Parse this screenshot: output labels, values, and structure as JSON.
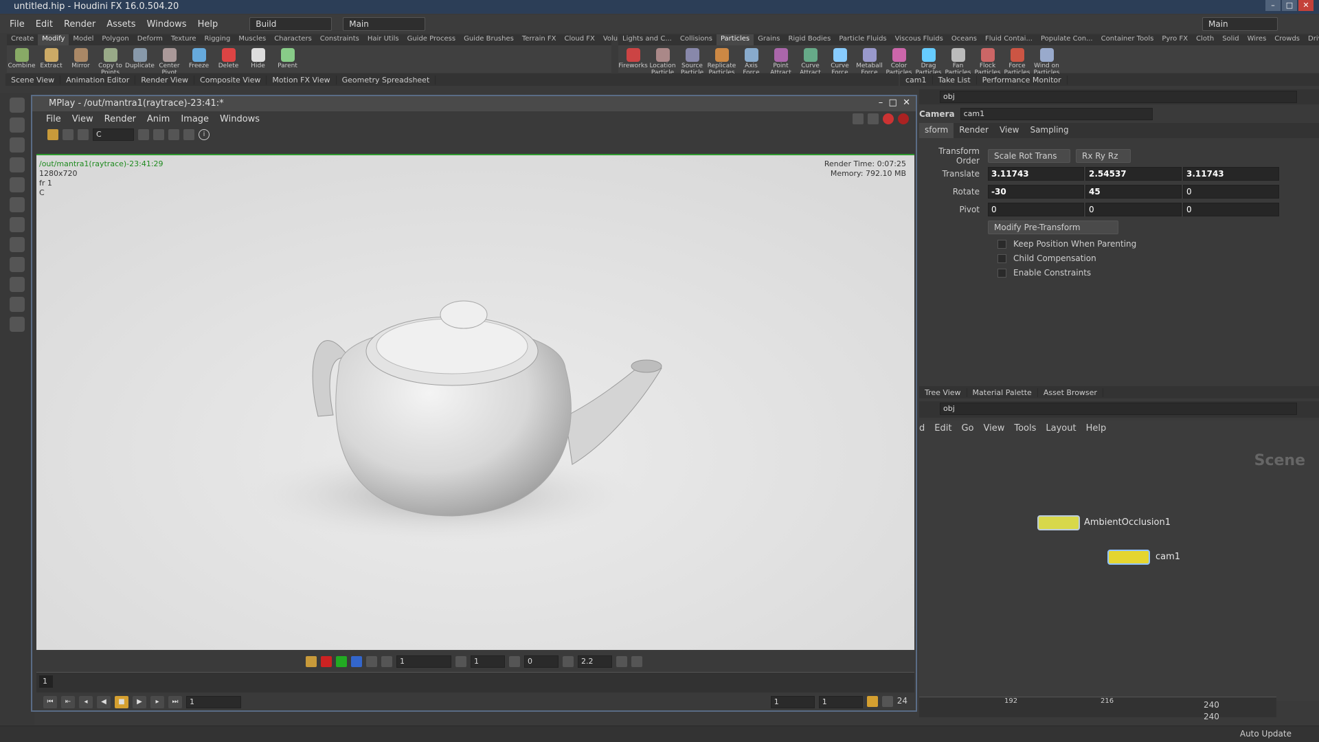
{
  "title": "untitled.hip - Houdini FX 16.0.504.20",
  "menu": [
    "File",
    "Edit",
    "Render",
    "Assets",
    "Windows",
    "Help"
  ],
  "desktop": {
    "build": "Build",
    "main": "Main",
    "right_main": "Main"
  },
  "shelf_tabs_left": [
    "Create",
    "Modify",
    "Model",
    "Polygon",
    "Deform",
    "Texture",
    "Rigging",
    "Muscles",
    "Characters",
    "Constraints",
    "Hair Utils",
    "Guide Process",
    "Guide Brushes",
    "Terrain FX",
    "Cloud FX",
    "Volume"
  ],
  "shelf_tabs_right": [
    "Lights and C...",
    "Collisions",
    "Particles",
    "Grains",
    "Rigid Bodies",
    "Particle Fluids",
    "Viscous Fluids",
    "Oceans",
    "Fluid Contai...",
    "Populate Con...",
    "Container Tools",
    "Pyro FX",
    "Cloth",
    "Solid",
    "Wires",
    "Crowds",
    "Drive Simula..."
  ],
  "tools_left": [
    "Combine",
    "Extract",
    "Mirror",
    "Copy to Points",
    "Duplicate",
    "Center Pivot",
    "Freeze",
    "Delete",
    "Hide",
    "Parent"
  ],
  "tools_right": [
    "Fireworks",
    "Location Particle Emi...",
    "Source Particle Emi...",
    "Replicate Particles",
    "Axis Force Particles",
    "Point Attract Particles",
    "Curve Attract Particles",
    "Curve Force Particles",
    "Metaball Force Partic...",
    "Color Particles",
    "Drag Particles",
    "Fan Particles",
    "Flock Particles",
    "Force Particles",
    "Wind on Particles"
  ],
  "pane_tabs_left": [
    "Scene View",
    "Animation Editor",
    "Render View",
    "Composite View",
    "Motion FX View",
    "Geometry Spreadsheet"
  ],
  "pane_tabs_right": [
    "cam1",
    "Take List",
    "Performance Monitor"
  ],
  "path": "obj",
  "mplay": {
    "title": "MPlay - /out/mantra1(raytrace)-23:41:*",
    "menu": [
      "File",
      "View",
      "Render",
      "Anim",
      "Image",
      "Windows"
    ],
    "channel": "C",
    "info_path": "/out/mantra1(raytrace)-23:41:29",
    "info_res": "1280x720",
    "info_fr": "fr 1",
    "info_c": "C",
    "render_time": "Render Time: 0:07:25",
    "memory": "Memory:   792.10 MB",
    "ctrl": {
      "exposure": "1",
      "gamma_val": "1",
      "offset": "0",
      "gamma": "2.2"
    },
    "frame_marker": "1",
    "frame": "1",
    "range_start": "1",
    "range_end": "1",
    "fps": "24"
  },
  "params": {
    "type": "Camera",
    "name": "cam1",
    "tabs": [
      "sform",
      "Render",
      "View",
      "Sampling"
    ],
    "transform_order_label": "Transform Order",
    "transform_order": "Scale Rot Trans",
    "rot_order": "Rx Ry Rz",
    "translate_label": "Translate",
    "translate": [
      "3.11743",
      "2.54537",
      "3.11743"
    ],
    "rotate_label": "Rotate",
    "rotate": [
      "-30",
      "45",
      "0"
    ],
    "pivot_label": "Pivot",
    "pivot": [
      "0",
      "0",
      "0"
    ],
    "modify_pre": "Modify Pre-Transform",
    "checks": [
      "Keep Position When Parenting",
      "Child Compensation",
      "Enable Constraints"
    ]
  },
  "network_tabs": [
    "Tree View",
    "Material Palette",
    "Asset Browser"
  ],
  "network_menu": [
    "d",
    "Edit",
    "Go",
    "View",
    "Tools",
    "Layout",
    "Help"
  ],
  "network_label": "Scene",
  "nodes": {
    "ao": "AmbientOcclusion1",
    "cam": "cam1"
  },
  "timeline": {
    "tick1": "192",
    "tick2": "216",
    "end1": "240",
    "end2": "240"
  },
  "status": "Auto Update"
}
